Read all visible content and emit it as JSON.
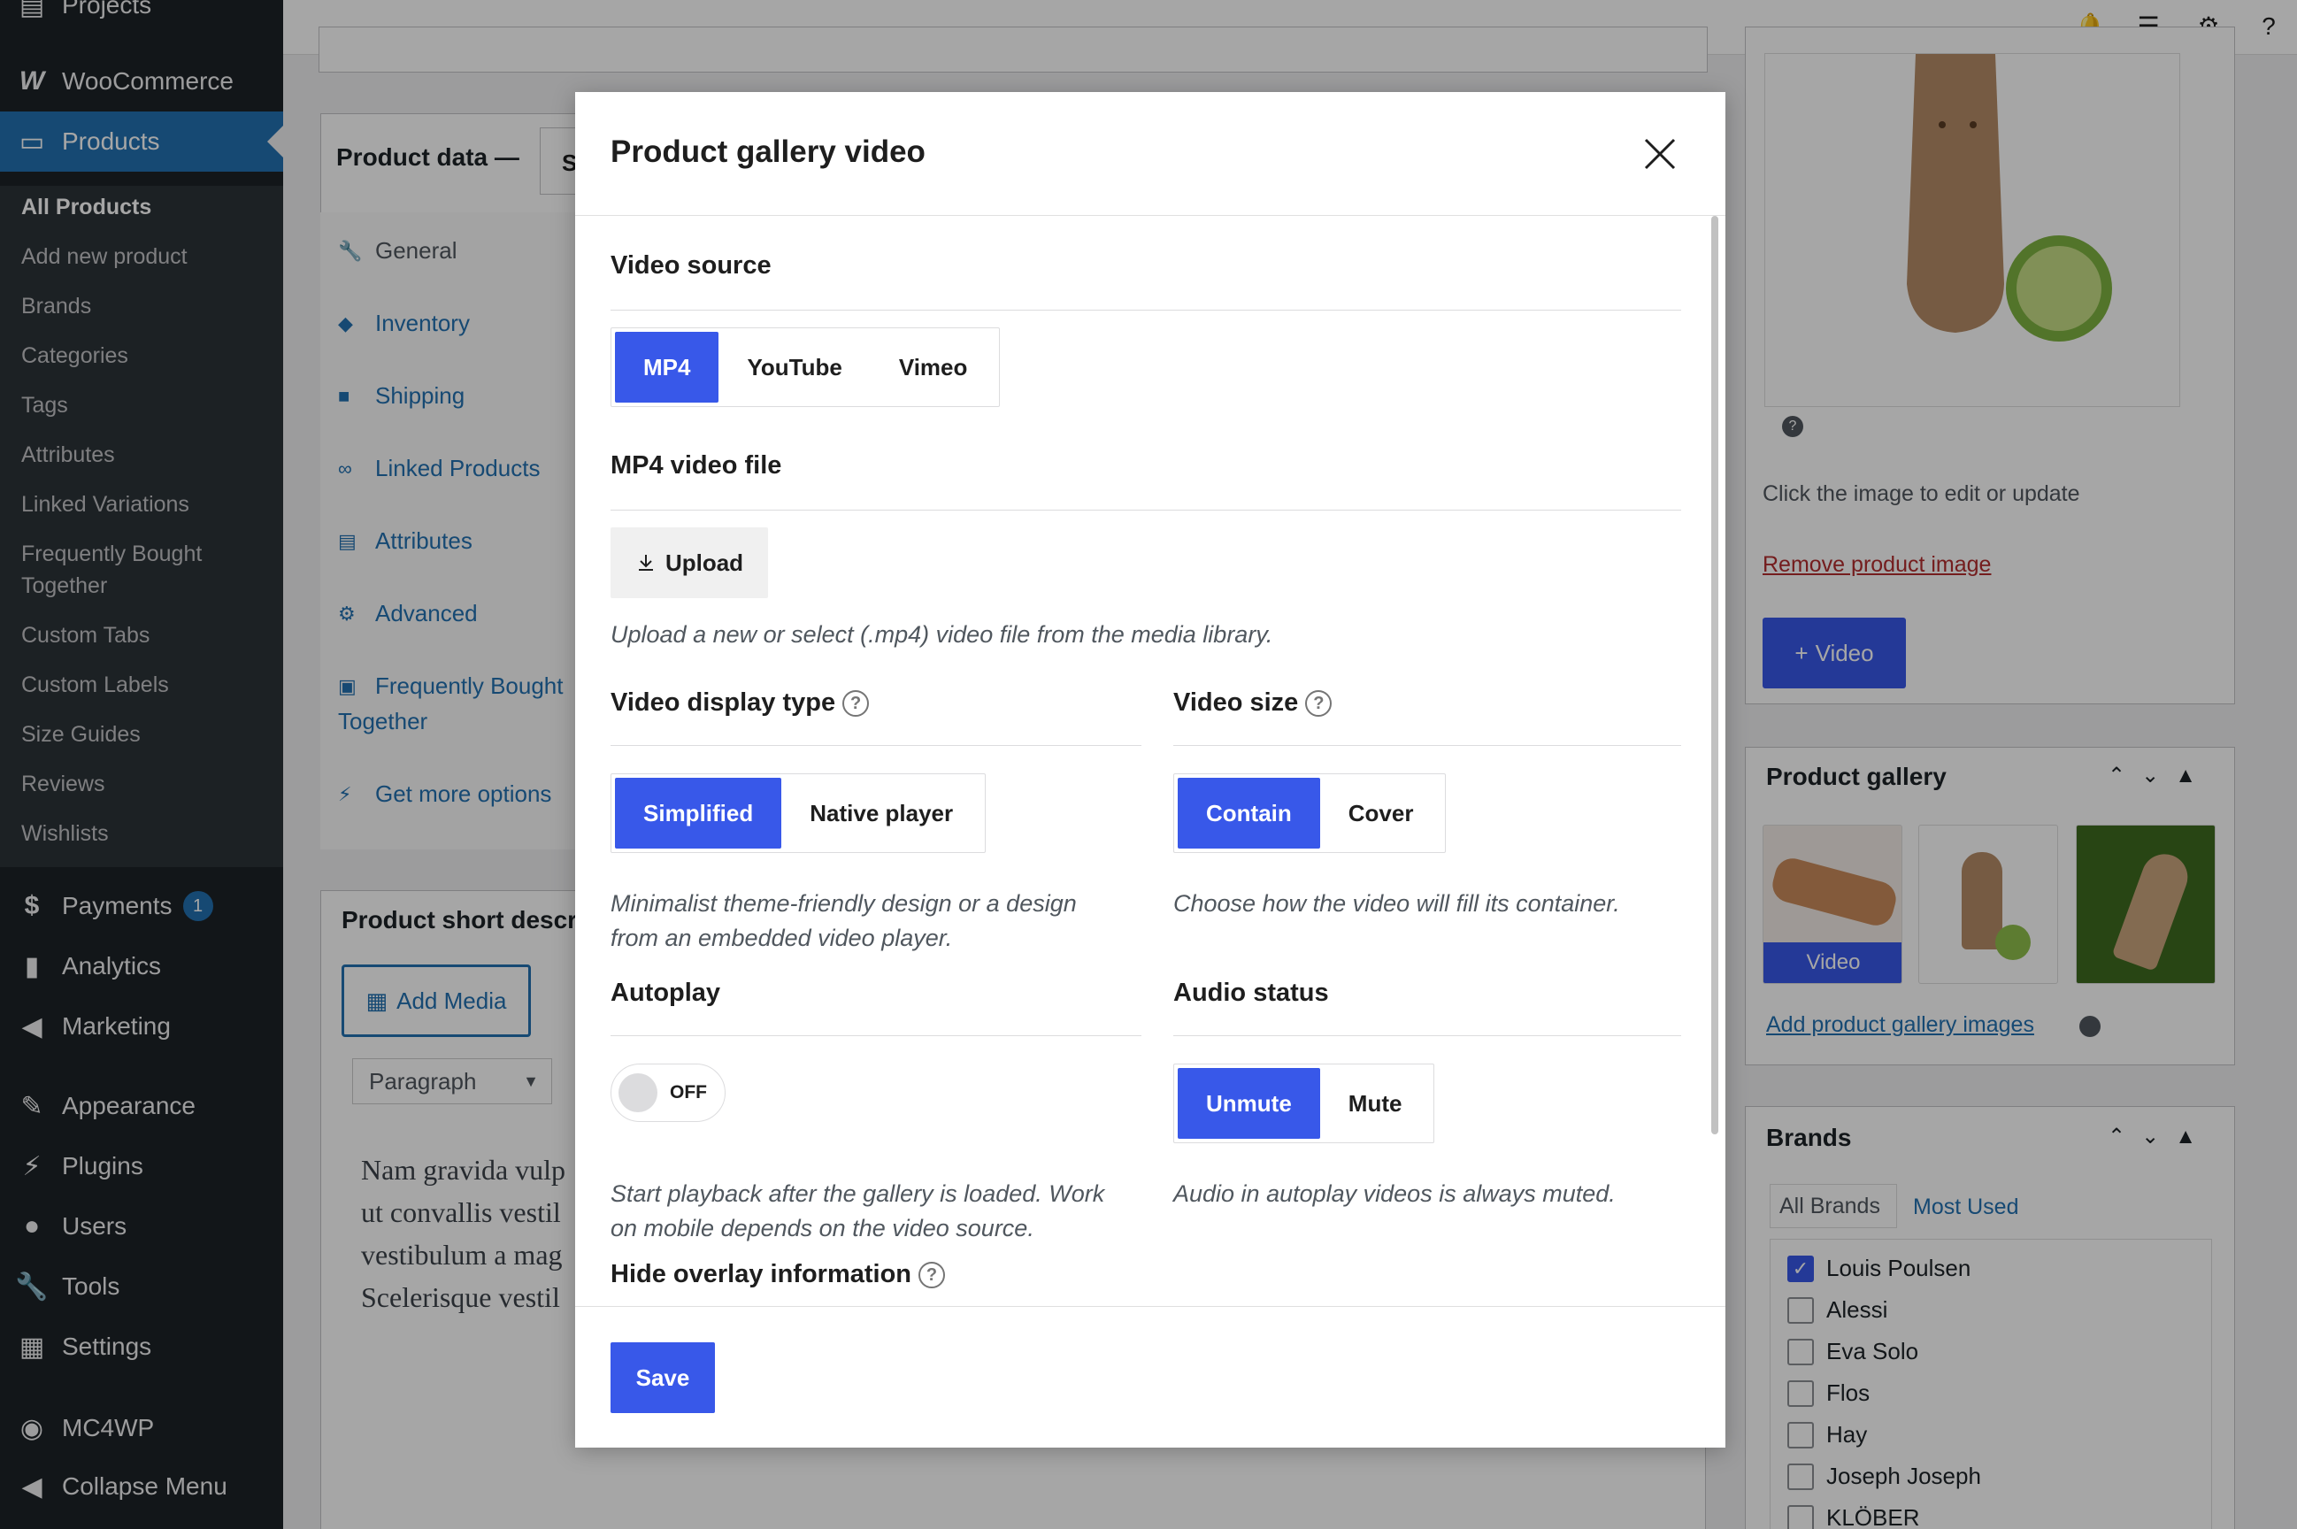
{
  "sidebar": {
    "top_partial": "Projects",
    "woocommerce": "WooCommerce",
    "products": "Products",
    "sub_items": [
      "All Products",
      "Add new product",
      "Brands",
      "Categories",
      "Tags",
      "Attributes",
      "Linked Variations",
      "Frequently Bought",
      "Together",
      "Custom Tabs",
      "Custom Labels",
      "Size Guides",
      "Reviews",
      "Wishlists"
    ],
    "payments": "Payments",
    "payments_badge": "1",
    "analytics": "Analytics",
    "marketing": "Marketing",
    "appearance": "Appearance",
    "plugins": "Plugins",
    "users": "Users",
    "tools": "Tools",
    "settings": "Settings",
    "mc4wp": "MC4WP",
    "collapse": "Collapse Menu"
  },
  "product_data": {
    "title": "Product data —",
    "select_partial": "S",
    "tabs": [
      "General",
      "Inventory",
      "Shipping",
      "Linked Products",
      "Attributes",
      "Advanced",
      "Frequently Bought",
      "Together",
      "Get more options"
    ]
  },
  "short_desc": {
    "title": "Product short descr",
    "add_media": "Add Media",
    "format": "Paragraph",
    "text_lines": [
      "Nam gravida vulp",
      "ut convallis vestil",
      "vestibulum a mag",
      "Scelerisque vestil"
    ]
  },
  "product_image": {
    "help_icon": "?",
    "note": "Click the image to edit or update",
    "remove": "Remove product image",
    "video_button": "Video"
  },
  "gallery": {
    "title": "Product gallery",
    "thumb_video": "Video",
    "add_link": "Add product gallery images"
  },
  "brands": {
    "title": "Brands",
    "tab_all": "All Brands",
    "tab_used": "Most Used",
    "items": [
      {
        "label": "Louis Poulsen",
        "checked": true
      },
      {
        "label": "Alessi",
        "checked": false
      },
      {
        "label": "Eva Solo",
        "checked": false
      },
      {
        "label": "Flos",
        "checked": false
      },
      {
        "label": "Hay",
        "checked": false
      },
      {
        "label": "Joseph Joseph",
        "checked": false
      },
      {
        "label": "KLÖBER",
        "checked": false
      }
    ]
  },
  "modal": {
    "title": "Product gallery video",
    "video_source": {
      "title": "Video source",
      "options": [
        "MP4",
        "YouTube",
        "Vimeo"
      ],
      "selected": "MP4"
    },
    "mp4_file": {
      "title": "MP4 video file",
      "upload_label": "Upload",
      "description": "Upload a new or select (.mp4) video file from the media library."
    },
    "display_type": {
      "title": "Video display type",
      "help": "?",
      "options": [
        "Simplified",
        "Native player"
      ],
      "selected": "Simplified",
      "description_lines": [
        "Minimalist theme-friendly design or a design",
        "from an embedded video player."
      ]
    },
    "video_size": {
      "title": "Video size",
      "help": "?",
      "options": [
        "Contain",
        "Cover"
      ],
      "selected": "Contain",
      "description": "Choose how the video will fill its container."
    },
    "autoplay": {
      "title": "Autoplay",
      "toggle_label": "OFF",
      "description_lines": [
        "Start playback after the gallery is loaded. Work",
        "on mobile depends on the video source."
      ]
    },
    "audio_status": {
      "title": "Audio status",
      "options": [
        "Unmute",
        "Mute"
      ],
      "selected": "Unmute",
      "description": "Audio in autoplay videos is always muted."
    },
    "hide_overlay": {
      "title": "Hide overlay information",
      "help": "?"
    },
    "save_label": "Save"
  },
  "colors": {
    "accent": "#3858e9",
    "wp_blue": "#2271b1",
    "sidebar_bg": "#1d2327"
  }
}
